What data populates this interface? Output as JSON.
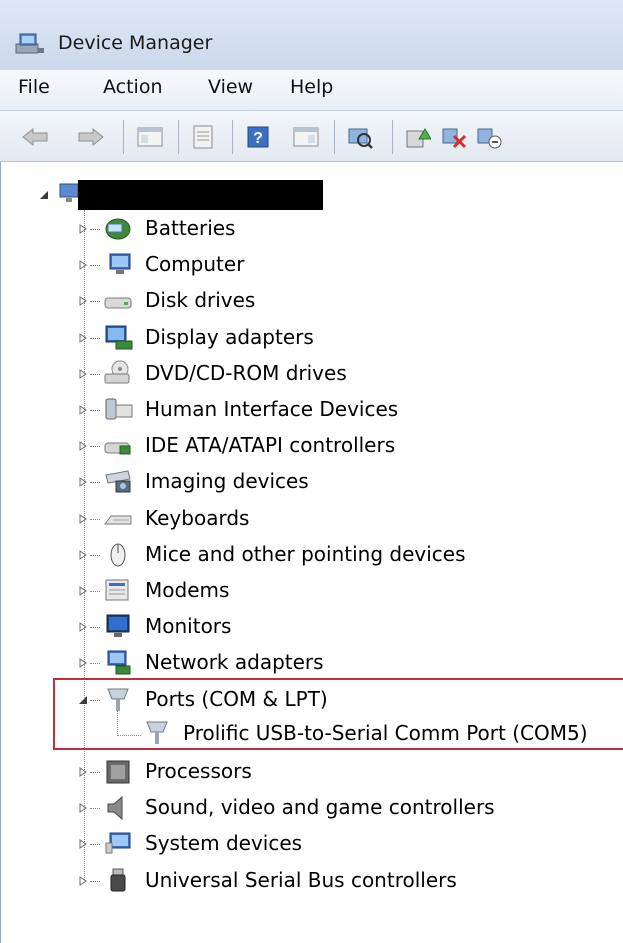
{
  "window": {
    "title": "Device Manager"
  },
  "menu": [
    "File",
    "Action",
    "View",
    "Help"
  ],
  "toolbar": {
    "buttons": [
      "back-arrow-icon",
      "forward-arrow-icon",
      "show-hide-console-tree-icon",
      "properties-icon",
      "help-icon",
      "action-pane-icon",
      "scan-hardware-icon",
      "update-driver-icon",
      "uninstall-icon",
      "disable-device-icon"
    ]
  },
  "tree": {
    "root_label": "",
    "categories": [
      {
        "label": "Batteries",
        "icon": "battery-icon"
      },
      {
        "label": "Computer",
        "icon": "computer-icon"
      },
      {
        "label": "Disk drives",
        "icon": "disk-drive-icon"
      },
      {
        "label": "Display adapters",
        "icon": "display-adapter-icon"
      },
      {
        "label": "DVD/CD-ROM drives",
        "icon": "dvd-drive-icon"
      },
      {
        "label": "Human Interface Devices",
        "icon": "hid-icon"
      },
      {
        "label": "IDE ATA/ATAPI controllers",
        "icon": "ide-controller-icon"
      },
      {
        "label": "Imaging devices",
        "icon": "imaging-device-icon"
      },
      {
        "label": "Keyboards",
        "icon": "keyboard-icon"
      },
      {
        "label": "Mice and other pointing devices",
        "icon": "mouse-icon"
      },
      {
        "label": "Modems",
        "icon": "modem-icon"
      },
      {
        "label": "Monitors",
        "icon": "monitor-icon"
      },
      {
        "label": "Network adapters",
        "icon": "network-adapter-icon"
      },
      {
        "label": "Ports (COM & LPT)",
        "icon": "port-icon",
        "expanded": true,
        "children": [
          {
            "label": "Prolific USB-to-Serial Comm Port (COM5)",
            "icon": "port-icon"
          }
        ]
      },
      {
        "label": "Processors",
        "icon": "processor-icon"
      },
      {
        "label": "Sound, video and game controllers",
        "icon": "speaker-icon"
      },
      {
        "label": "System devices",
        "icon": "system-device-icon"
      },
      {
        "label": "Universal Serial Bus controllers",
        "icon": "usb-icon"
      }
    ]
  },
  "colors": {
    "highlight_border": "#c0303a"
  }
}
